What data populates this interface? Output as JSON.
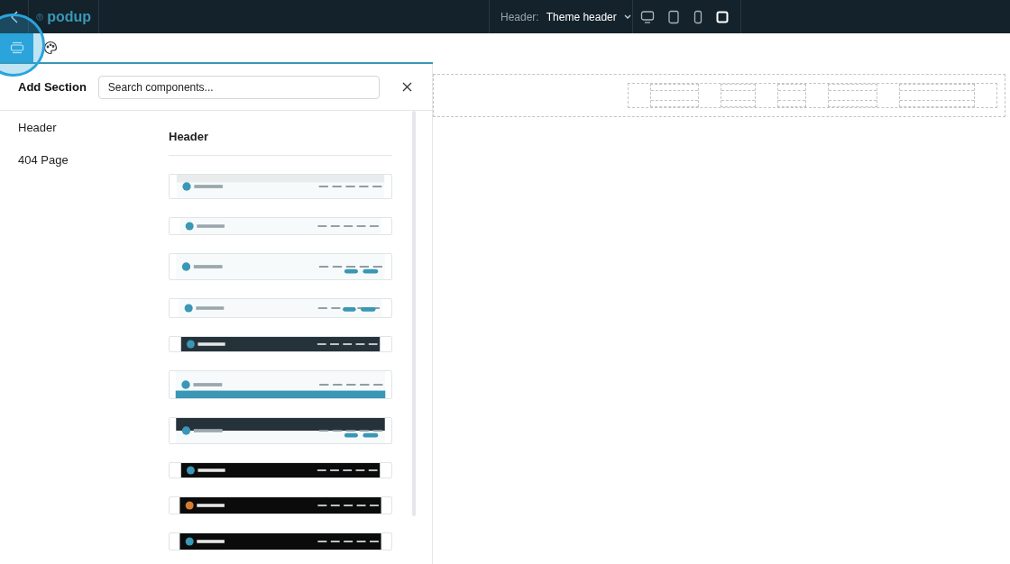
{
  "topbar": {
    "logo": "podup",
    "header_label": "Header:",
    "header_value": "Theme header",
    "devices": [
      {
        "kind": "desktop",
        "selected": false
      },
      {
        "kind": "tablet",
        "selected": false
      },
      {
        "kind": "phone",
        "selected": false
      },
      {
        "kind": "square",
        "selected": true
      }
    ]
  },
  "toolbar": {
    "tabs": [
      {
        "kind": "sections",
        "selected": true
      },
      {
        "kind": "palette",
        "selected": false
      }
    ]
  },
  "panel": {
    "title": "Add Section",
    "search": {
      "placeholder": "Search components..."
    },
    "categories": [
      {
        "label": "Header",
        "selected": false
      },
      {
        "label": "404 Page",
        "selected": false
      }
    ],
    "group_title": "Header"
  }
}
